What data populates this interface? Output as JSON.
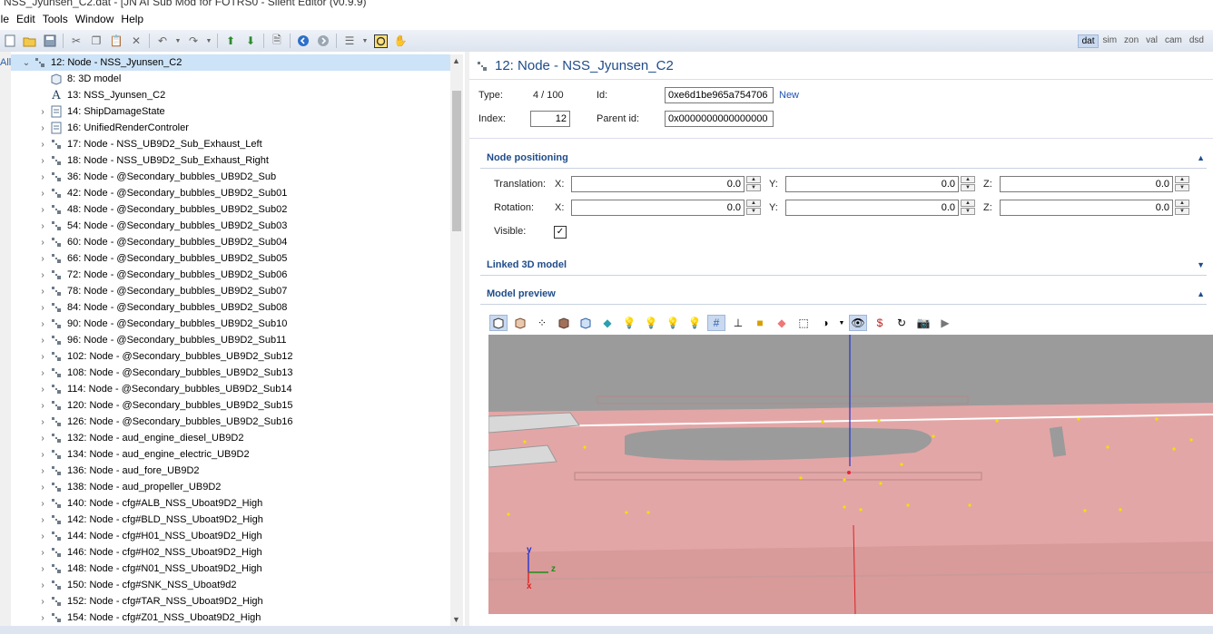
{
  "window": {
    "title": "NSS_Jyunsen_C2.dat - [JN AI Sub Mod for FOTRS0 - Silent Editor (v0.9.9)"
  },
  "menu": [
    "ile",
    "Edit",
    "Tools",
    "Window",
    "Help"
  ],
  "modes": [
    {
      "label": "dat",
      "active": true
    },
    {
      "label": "sim",
      "active": false
    },
    {
      "label": "zon",
      "active": false
    },
    {
      "label": "val",
      "active": false
    },
    {
      "label": "cam",
      "active": false
    },
    {
      "label": "dsd",
      "active": false
    }
  ],
  "leftstrip": {
    "label": "All"
  },
  "tree": {
    "root": "12: Node - NSS_Jyunsen_C2",
    "items": [
      {
        "label": "8: 3D model",
        "icon": "cube-icon",
        "expander": false
      },
      {
        "label": "13: NSS_Jyunsen_C2",
        "icon": "text-icon",
        "expander": false
      },
      {
        "label": "14: ShipDamageState",
        "icon": "document-icon",
        "expander": true
      },
      {
        "label": "16: UnifiedRenderControler",
        "icon": "document-icon",
        "expander": true
      },
      {
        "label": "17: Node - NSS_UB9D2_Sub_Exhaust_Left",
        "icon": "node-icon",
        "expander": true
      },
      {
        "label": "18: Node - NSS_UB9D2_Sub_Exhaust_Right",
        "icon": "node-icon",
        "expander": true
      },
      {
        "label": "36: Node - @Secondary_bubbles_UB9D2_Sub",
        "icon": "node-icon",
        "expander": true
      },
      {
        "label": "42: Node - @Secondary_bubbles_UB9D2_Sub01",
        "icon": "node-icon",
        "expander": true
      },
      {
        "label": "48: Node - @Secondary_bubbles_UB9D2_Sub02",
        "icon": "node-icon",
        "expander": true
      },
      {
        "label": "54: Node - @Secondary_bubbles_UB9D2_Sub03",
        "icon": "node-icon",
        "expander": true
      },
      {
        "label": "60: Node - @Secondary_bubbles_UB9D2_Sub04",
        "icon": "node-icon",
        "expander": true
      },
      {
        "label": "66: Node - @Secondary_bubbles_UB9D2_Sub05",
        "icon": "node-icon",
        "expander": true
      },
      {
        "label": "72: Node - @Secondary_bubbles_UB9D2_Sub06",
        "icon": "node-icon",
        "expander": true
      },
      {
        "label": "78: Node - @Secondary_bubbles_UB9D2_Sub07",
        "icon": "node-icon",
        "expander": true
      },
      {
        "label": "84: Node - @Secondary_bubbles_UB9D2_Sub08",
        "icon": "node-icon",
        "expander": true
      },
      {
        "label": "90: Node - @Secondary_bubbles_UB9D2_Sub10",
        "icon": "node-icon",
        "expander": true
      },
      {
        "label": "96: Node - @Secondary_bubbles_UB9D2_Sub11",
        "icon": "node-icon",
        "expander": true
      },
      {
        "label": "102: Node - @Secondary_bubbles_UB9D2_Sub12",
        "icon": "node-icon",
        "expander": true
      },
      {
        "label": "108: Node - @Secondary_bubbles_UB9D2_Sub13",
        "icon": "node-icon",
        "expander": true
      },
      {
        "label": "114: Node - @Secondary_bubbles_UB9D2_Sub14",
        "icon": "node-icon",
        "expander": true
      },
      {
        "label": "120: Node - @Secondary_bubbles_UB9D2_Sub15",
        "icon": "node-icon",
        "expander": true
      },
      {
        "label": "126: Node - @Secondary_bubbles_UB9D2_Sub16",
        "icon": "node-icon",
        "expander": true
      },
      {
        "label": "132: Node - aud_engine_diesel_UB9D2",
        "icon": "node-icon",
        "expander": true
      },
      {
        "label": "134: Node - aud_engine_electric_UB9D2",
        "icon": "node-icon",
        "expander": true
      },
      {
        "label": "136: Node - aud_fore_UB9D2",
        "icon": "node-icon",
        "expander": true
      },
      {
        "label": "138: Node - aud_propeller_UB9D2",
        "icon": "node-icon",
        "expander": true
      },
      {
        "label": "140: Node - cfg#ALB_NSS_Uboat9D2_High",
        "icon": "node-icon",
        "expander": true
      },
      {
        "label": "142: Node - cfg#BLD_NSS_Uboat9D2_High",
        "icon": "node-icon",
        "expander": true
      },
      {
        "label": "144: Node - cfg#H01_NSS_Uboat9D2_High",
        "icon": "node-icon",
        "expander": true
      },
      {
        "label": "146: Node - cfg#H02_NSS_Uboat9D2_High",
        "icon": "node-icon",
        "expander": true
      },
      {
        "label": "148: Node - cfg#N01_NSS_Uboat9D2_High",
        "icon": "node-icon",
        "expander": true
      },
      {
        "label": "150: Node - cfg#SNK_NSS_Uboat9d2",
        "icon": "node-icon",
        "expander": true
      },
      {
        "label": "152: Node - cfg#TAR_NSS_Uboat9D2_High",
        "icon": "node-icon",
        "expander": true
      },
      {
        "label": "154: Node - cfg#Z01_NSS_Uboat9D2_High",
        "icon": "node-icon",
        "expander": true
      }
    ]
  },
  "detail": {
    "title": "12: Node - NSS_Jyunsen_C2",
    "type_label": "Type:",
    "type_value": "4 / 100",
    "id_label": "Id:",
    "id_value": "0xe6d1be965a754706",
    "new_link": "New",
    "index_label": "Index:",
    "index_value": "12",
    "parent_label": "Parent id:",
    "parent_value": "0x0000000000000000"
  },
  "positioning": {
    "title": "Node positioning",
    "translation_label": "Translation:",
    "rotation_label": "Rotation:",
    "visible_label": "Visible:",
    "visible": true,
    "axes": [
      "X:",
      "Y:",
      "Z:"
    ],
    "translation": [
      "0.0",
      "0.0",
      "0.0"
    ],
    "rotation": [
      "0.0",
      "0.0",
      "0.0"
    ]
  },
  "linked": {
    "title": "Linked 3D model"
  },
  "preview": {
    "title": "Model preview",
    "axis_y": "y",
    "axis_z": "z",
    "axis_x": "x"
  }
}
